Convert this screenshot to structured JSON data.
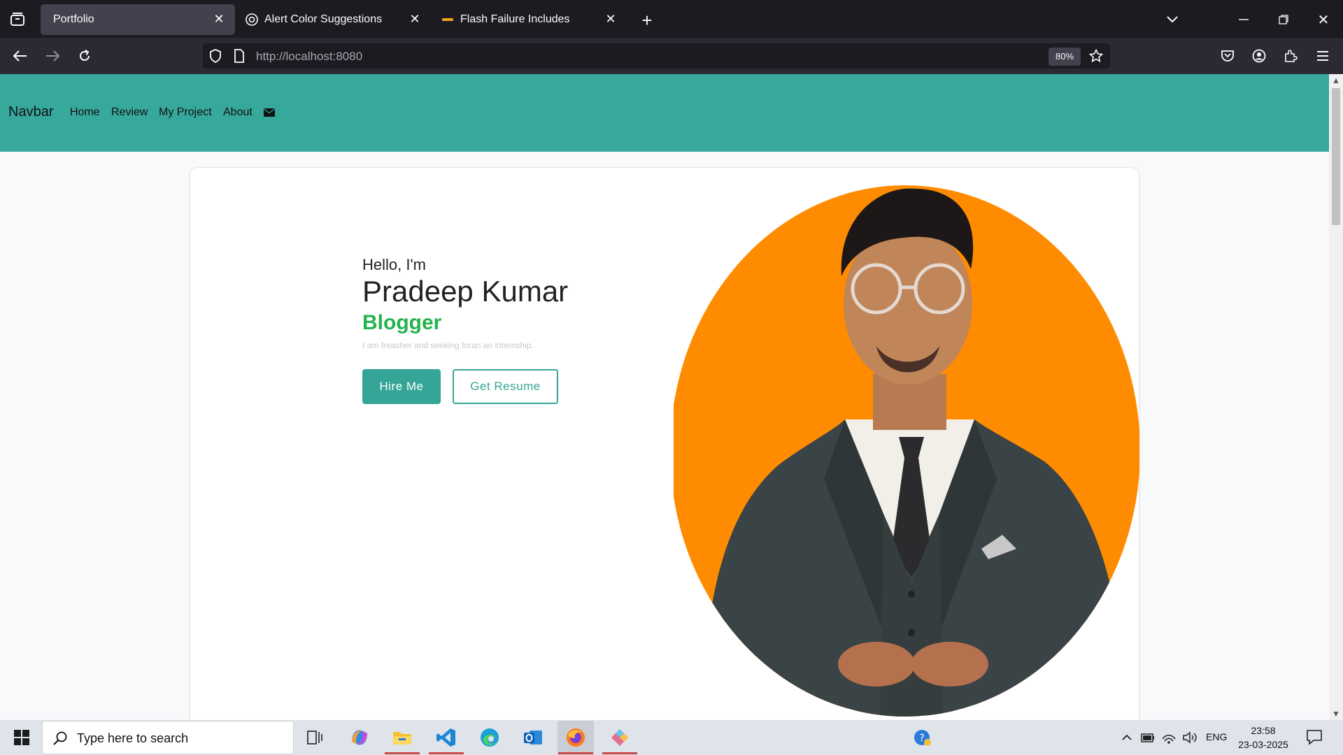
{
  "browser": {
    "tabs": [
      {
        "title": "Portfolio",
        "active": true
      },
      {
        "title": "Alert Color Suggestions",
        "active": false
      },
      {
        "title": "Flash Failure Includes",
        "active": false
      }
    ],
    "url_host": "http://localhost",
    "url_port": ":8080",
    "zoom": "80%"
  },
  "site": {
    "brand": "Navbar",
    "nav_links": [
      "Home",
      "Review",
      "My Project",
      "About"
    ],
    "greeting": "Hello, I'm",
    "name": "Pradeep Kumar",
    "role": "Blogger",
    "description": "I am freasher and seeking foran an internship.",
    "hire_label": "Hire Me",
    "resume_label": "Get Resume",
    "colors": {
      "navbar": "#37a89c",
      "accent": "#34a596",
      "role": "#24b34b",
      "portrait_bg": "#ff8c00"
    }
  },
  "taskbar": {
    "search_placeholder": "Type here to search",
    "language": "ENG",
    "time": "23:58",
    "date": "23-03-2025",
    "apps": [
      "task-view",
      "copilot",
      "file-explorer",
      "vs-code",
      "edge",
      "outlook",
      "firefox",
      "git-tool"
    ]
  }
}
